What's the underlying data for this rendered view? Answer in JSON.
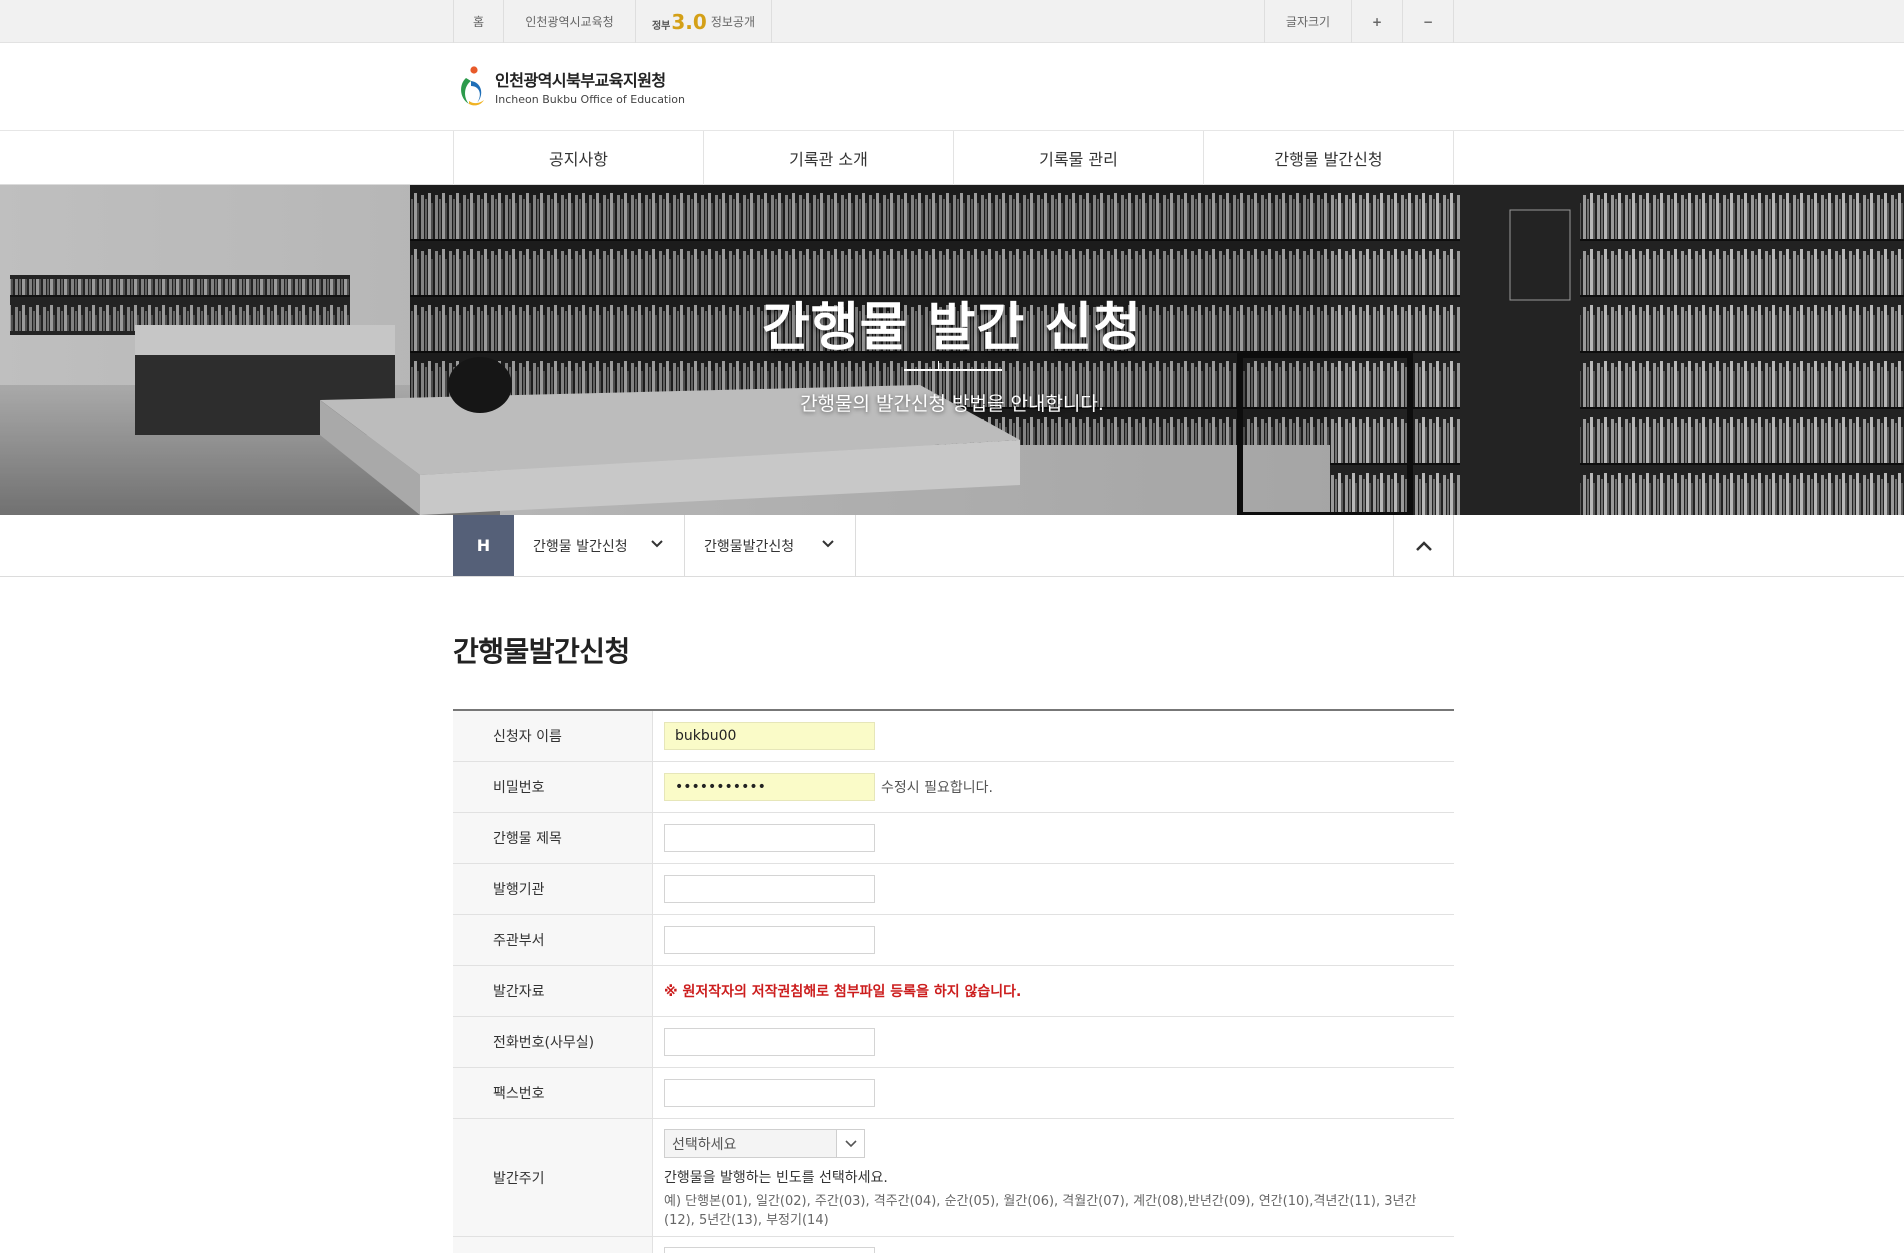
{
  "topbar": {
    "home": "홈",
    "office": "인천광역시교육청",
    "gov_badge": {
      "left": "정부",
      "number": "3.0",
      "right": ""
    },
    "info_open": "정보공개",
    "font_size": "글자크기",
    "plus": "+",
    "minus": "−"
  },
  "header": {
    "logo_name_ko": "인천광역시북부교육지원청",
    "logo_name_en": "Incheon Bukbu Office of Education"
  },
  "gnb": {
    "items": [
      "공지사항",
      "기록관 소개",
      "기록물 관리",
      "간행물 발간신청"
    ]
  },
  "hero": {
    "title": "간행물 발간 신청",
    "subtitle": "간행물의 발간신청 방법을 안내합니다."
  },
  "location": {
    "home": "H",
    "depth1": "간행물 발간신청",
    "depth2": "간행물발간신청"
  },
  "page": {
    "title": "간행물발간신청"
  },
  "form": {
    "applicant_label": "신청자 이름",
    "applicant_value": "bukbu00",
    "password_label": "비밀번호",
    "password_value": "•••••••••••",
    "password_hint": "수정시 필요합니다.",
    "pub_title_label": "간행물 제목",
    "publisher_label": "발행기관",
    "dept_label": "주관부서",
    "material_label": "발간자료",
    "material_warning": "※ 원저작자의 저작권침해로 첨부파일 등록을 하지 않습니다.",
    "phone_label": "전화번호(사무실)",
    "fax_label": "팩스번호",
    "cycle_label": "발간주기",
    "cycle_select": "선택하세요",
    "cycle_help": "간행물을 발행하는 빈도를 선택하세요.",
    "cycle_example": "예) 단행본(01), 일간(02), 주간(03), 격주간(04), 순간(05), 월간(06), 격월간(07), 계간(08),반년간(09), 연간(10),격년간(11), 3년간(12), 5년간(13), 부정기(14)"
  },
  "colors": {
    "location_home_bg": "#556078",
    "autofill_bg": "#fafbc8",
    "warning": "#cc1d1d"
  }
}
